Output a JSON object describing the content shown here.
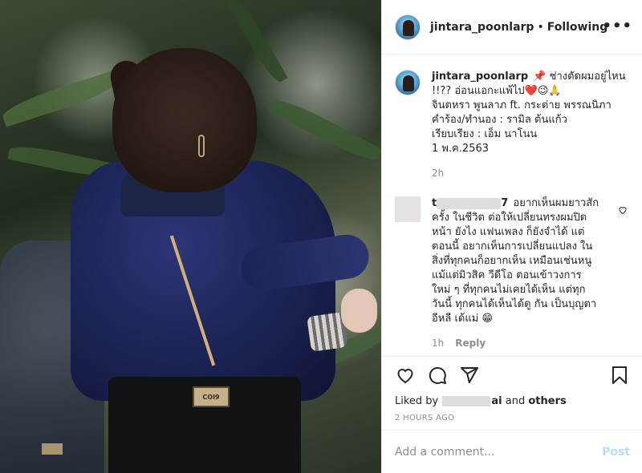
{
  "header": {
    "username": "jintara_poonlarp",
    "separator": "•",
    "follow_status": "Following",
    "more_label": "•••"
  },
  "caption": {
    "username": "jintara_poonlarp",
    "lines": [
      "📌 ช่างตัดผมอยู่ไหน",
      "!!?? อ่อนแอกะแพ้ไป❤️😉🙏",
      "จินตหรา พูนลาภ ft. กระต่าย พรรณนิภา",
      "คำร้อง/ทำนอง : รามิล ต้นแก้ว",
      "เรียบเรียง : เอ็ม นาโนน",
      "1 พ.ค.2563"
    ],
    "time": "2h"
  },
  "comment": {
    "username_visible": "t",
    "username_end": "7",
    "lines": [
      "อยากเห็นผมยาวสัก",
      "ครั้ง ในชีวิต ต่อให้เปลี่ยนทรงผมปิด",
      "หน้า ยังไง แฟนเพลง ก็ยังจำได้ แต่",
      "ตอนนี้ อยากเห็นการเปลี่ยนแปลง ใน",
      "สิ่งที่ทุกคนก็อยากเห็น เหมือนเช่นหนู",
      "แม้แต่มิวสิค วีดีโอ ตอนเข้าวงการ",
      "ใหม่ ๆ ที่ทุกคนไม่เคยได้เห็น แต่ทุก",
      "วันนี้ ทุกคนได้เห็นได้ดู กัน เป็นบุญตา",
      "อีหลี เด้แม่ 😁"
    ],
    "time": "1h",
    "reply_label": "Reply"
  },
  "actions": {
    "liked_by_prefix": "Liked by",
    "liked_by_suffix": "ai",
    "and_word": "and",
    "others": "others",
    "timestamp": "2 HOURS AGO"
  },
  "add_comment": {
    "placeholder": "Add a comment...",
    "post_label": "Post"
  },
  "photo": {
    "belt_text": "COI9"
  },
  "icons": {
    "like": "heart-icon",
    "comment": "comment-icon",
    "share": "share-icon",
    "save": "bookmark-icon",
    "comment_like": "heart-icon"
  }
}
